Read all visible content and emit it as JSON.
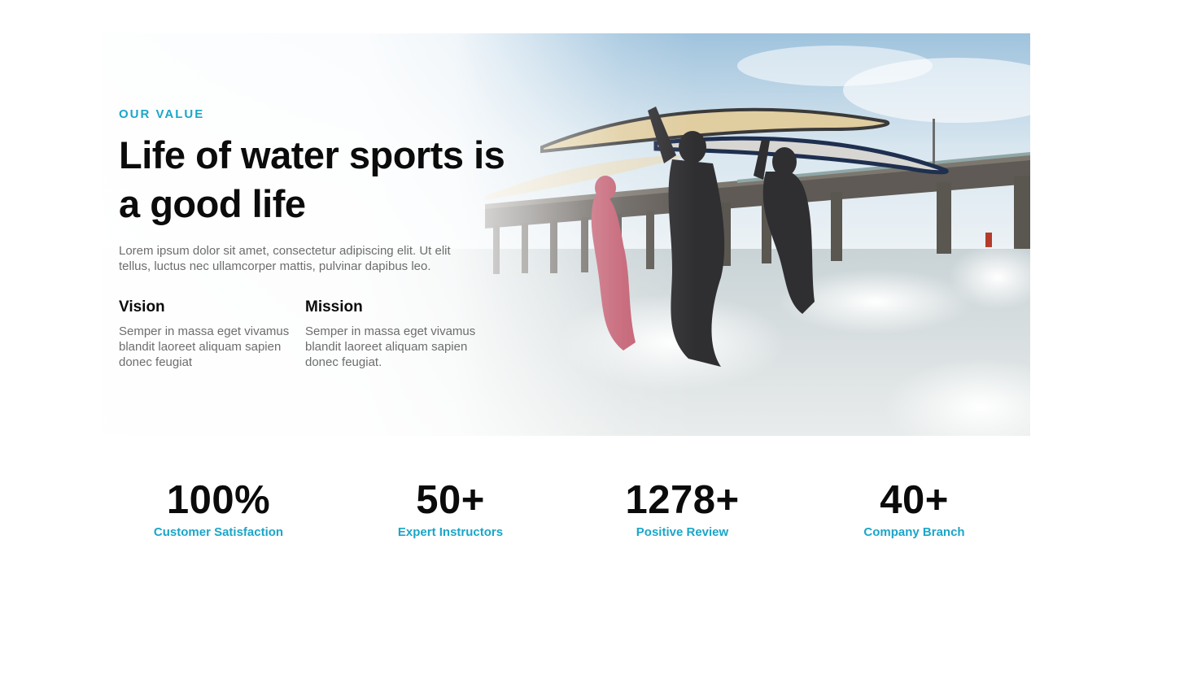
{
  "colors": {
    "accent": "#1aa6c9",
    "heading": "#0b0b0b",
    "body_text": "#6d6d6d",
    "background": "#ffffff"
  },
  "hero": {
    "image_icon": "surfers-running-into-sea-photo",
    "eyebrow": "OUR VALUE",
    "title": "Life of water sports is a good life",
    "intro": "Lorem ipsum dolor sit amet, consectetur adipiscing elit. Ut elit tellus, luctus nec ullamcorper mattis, pulvinar dapibus leo.",
    "vision": {
      "title": "Vision",
      "text": "Semper in massa eget vivamus blandit laoreet aliquam sapien donec feugiat"
    },
    "mission": {
      "title": "Mission",
      "text": "Semper in massa eget vivamus blandit laoreet aliquam sapien donec feugiat."
    }
  },
  "stats": [
    {
      "value": "100%",
      "label": "Customer Satisfaction"
    },
    {
      "value": "50+",
      "label": "Expert Instructors"
    },
    {
      "value": "1278+",
      "label": "Positive Review"
    },
    {
      "value": "40+",
      "label": "Company Branch"
    }
  ]
}
